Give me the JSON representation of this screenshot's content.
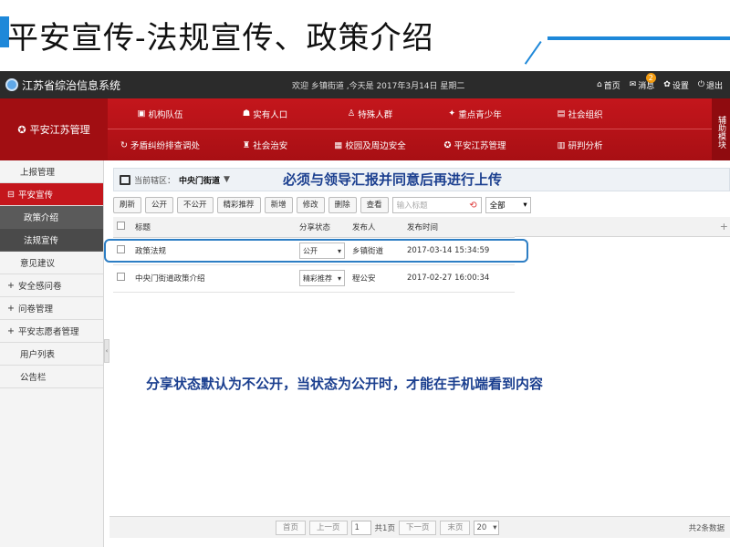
{
  "slide": {
    "title": "平安宣传-法规宣传、政策介绍",
    "annotation_top": "必须与领导汇报并同意后再进行上传",
    "annotation_bottom": "分享状态默认为不公开，当状态为公开时，才能在手机端看到内容"
  },
  "app": {
    "name": "江苏省综治信息系统",
    "welcome": "欢迎 乡镇街道 ,今天是 2017年3月14日 星期二",
    "header_links": {
      "home": "首页",
      "messages": "消息",
      "message_count": "2",
      "settings": "设置",
      "logout": "退出"
    }
  },
  "module": {
    "title": "平安江苏管理",
    "aux_label": "辅助模块"
  },
  "menu": {
    "row1": [
      "机构队伍",
      "实有人口",
      "特殊人群",
      "重点青少年",
      "社会组织"
    ],
    "row2": [
      "矛盾纠纷排查调处",
      "社会治安",
      "校园及周边安全",
      "平安江苏管理",
      "研判分析"
    ]
  },
  "sidebar": {
    "items": [
      {
        "label": "上报管理"
      },
      {
        "label": "平安宣传"
      },
      {
        "label": "政策介绍"
      },
      {
        "label": "法规宣传"
      },
      {
        "label": "意见建议"
      },
      {
        "label": "安全感问卷"
      },
      {
        "label": "问卷管理"
      },
      {
        "label": "平安志愿者管理"
      },
      {
        "label": "用户列表"
      },
      {
        "label": "公告栏"
      }
    ]
  },
  "breadcrumb": {
    "prefix": "当前辖区：",
    "area": "中央门街道"
  },
  "toolbar": {
    "buttons": [
      "刷新",
      "公开",
      "不公开",
      "精彩推荐",
      "新增",
      "修改",
      "删除",
      "查看"
    ],
    "search_placeholder": "输入标题",
    "filter_value": "全部"
  },
  "table": {
    "columns": [
      "标题",
      "分享状态",
      "发布人",
      "发布时间"
    ],
    "rows": [
      {
        "title": "政策法规",
        "status": "公开",
        "publisher": "乡镇街道",
        "time": "2017-03-14 15:34:59"
      },
      {
        "title": "中央门街道政策介绍",
        "status": "精彩推荐",
        "publisher": "程公安",
        "time": "2017-02-27 16:00:34"
      }
    ]
  },
  "pager": {
    "first": "首页",
    "prev": "上一页",
    "page": "1",
    "total_pages": "共1页",
    "next": "下一页",
    "last": "末页",
    "page_size": "20",
    "total": "共2条数据"
  }
}
